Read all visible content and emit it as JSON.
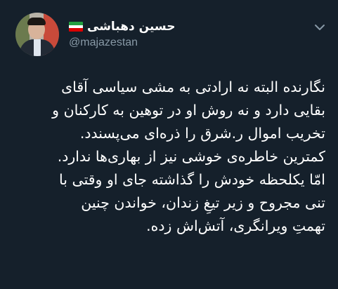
{
  "user": {
    "display_name": "حسین دهباشی",
    "handle": "@majazestan",
    "flag_icon": "iran-flag-icon"
  },
  "menu": {
    "icon": "chevron-down-icon"
  },
  "tweet": {
    "text": "نگارنده البته نه ارادتی به مشی سیاسی آقای\nبقایی دارد و نه روش او در توهین به کارکنان و\nتخریب اموال ر.شرق را ذره‌ای می‌پسندد.\nکمترین خاطره‌ی خوشی نیز از بهاری‌ها ندارد.\nامّا یکلحظه خودش را گذاشته جای او وقتی با\nتنی مجروح و زیر تیغِ زندان، خواندن چنین\nتهمتِ ویرانگری، آتش‌اش زده."
  },
  "colors": {
    "background": "#15202b",
    "text": "#ffffff",
    "secondary_text": "#8899a6"
  }
}
